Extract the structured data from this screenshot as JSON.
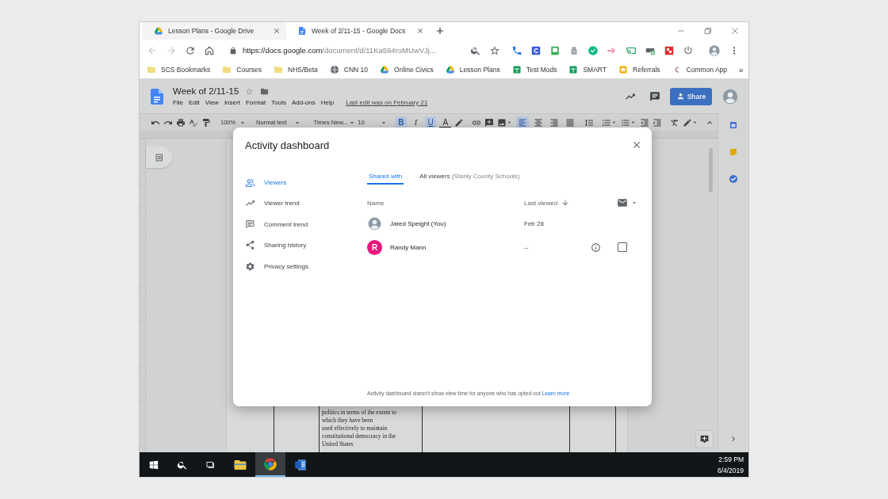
{
  "browser": {
    "tabs": [
      {
        "title": "Lesson Plans - Google Drive",
        "kind": "drive",
        "selected": false
      },
      {
        "title": "Week of 2/11-15 - Google Docs",
        "kind": "docs",
        "selected": true
      }
    ],
    "url": {
      "host": "https://docs.google.com",
      "path": "/document/d/11Ka594roMUwVJj..."
    },
    "bookmarks": [
      {
        "label": "SCS Bookmarks",
        "kind": "folder"
      },
      {
        "label": "Courses",
        "kind": "folder"
      },
      {
        "label": "NHS/Beta",
        "kind": "folder"
      },
      {
        "label": "CNN 10",
        "kind": "globe"
      },
      {
        "label": "Online Civics",
        "kind": "drive"
      },
      {
        "label": "Lesson Plans",
        "kind": "drive"
      },
      {
        "label": "Test Mods",
        "kind": "sheet"
      },
      {
        "label": "SMART",
        "kind": "sheet"
      },
      {
        "label": "Referrals",
        "kind": "slides"
      },
      {
        "label": "Common App",
        "kind": "ca"
      }
    ],
    "bookmarks_overflow": "»"
  },
  "document": {
    "title": "Week of 2/11-15",
    "menu": [
      "File",
      "Edit",
      "View",
      "Insert",
      "Format",
      "Tools",
      "Add-ons",
      "Help"
    ],
    "last_edit": "Last edit was on February 21",
    "share": "Share",
    "toolbar": {
      "zoom": "100%",
      "style": "Normal text",
      "font": "Times New...",
      "size": "10",
      "format": [
        {
          "glyph": "B",
          "kind": "style",
          "on": true
        },
        {
          "glyph": "I",
          "kind": "style",
          "on": false
        },
        {
          "glyph": "U",
          "kind": "style",
          "on": true
        },
        {
          "glyph": "A",
          "kind": "color",
          "on": false
        }
      ],
      "alignment": [
        {
          "kind": "left",
          "selected": true
        },
        {
          "kind": "center",
          "selected": false
        },
        {
          "kind": "right",
          "selected": false
        },
        {
          "kind": "justify",
          "selected": false
        }
      ]
    },
    "cell_lines": [
      "politics in terms of the extent to",
      "which they have been",
      "used effectively to maintain",
      "constitutional democracy in the",
      "United States"
    ]
  },
  "dialog": {
    "title": "Activity dashboard",
    "nav": [
      {
        "label": "Viewers",
        "kind": "people",
        "selected": true
      },
      {
        "label": "Viewer trend",
        "kind": "trend",
        "selected": false
      },
      {
        "label": "Comment trend",
        "kind": "comment",
        "selected": false
      },
      {
        "label": "Sharing history",
        "kind": "share",
        "selected": false
      },
      {
        "label": "Privacy settings",
        "kind": "gear",
        "selected": false
      }
    ],
    "tabs": [
      {
        "label": "Shared with",
        "selected": true
      },
      {
        "label": "All viewers",
        "note": "(Stanly County Schools)",
        "selected": false
      }
    ],
    "columns": {
      "name": "Name",
      "last_viewed": "Last viewed"
    },
    "rows": [
      {
        "kind": "self",
        "name": "Jared Speight (You)",
        "last_viewed": "Feb 28"
      },
      {
        "kind": "viewer",
        "initial": "R",
        "color": "#e8177d",
        "name": "Randy Mann",
        "last_viewed": "--",
        "checked": false
      }
    ],
    "footer": "Activity dashboard doesn't show view time for anyone who has opted out",
    "learn_more": "Learn more"
  },
  "taskbar": {
    "apps": [
      {
        "kind": "explorer",
        "selected": false
      },
      {
        "kind": "chrome",
        "selected": true
      },
      {
        "kind": "word",
        "selected": false
      }
    ],
    "time": "2:59 PM",
    "date": "6/4/2019"
  }
}
